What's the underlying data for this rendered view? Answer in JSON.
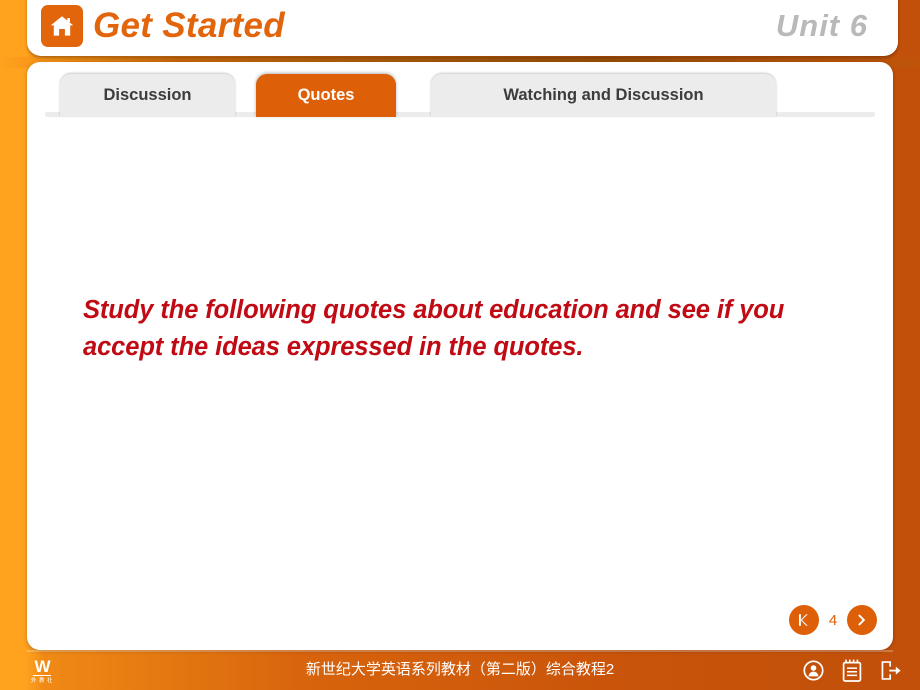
{
  "header": {
    "home_icon": "home-icon",
    "title": "Get Started",
    "unit": "Unit  6"
  },
  "tabs": [
    {
      "label": "Discussion",
      "active": false
    },
    {
      "label": "Quotes",
      "active": true
    },
    {
      "label": "Watching and Discussion",
      "active": false
    }
  ],
  "content": {
    "instruction": "Study the following quotes about education and see if you accept the ideas expressed in the quotes."
  },
  "pager": {
    "prev_icon": "previous-icon",
    "page_number": "4",
    "next_icon": "next-icon"
  },
  "footer": {
    "logo_mark": "W",
    "logo_sub": "外 教 社",
    "title": "新世纪大学英语系列教材（第二版）综合教程2",
    "icons": [
      {
        "name": "user-icon"
      },
      {
        "name": "notepad-icon"
      },
      {
        "name": "exit-icon"
      }
    ]
  },
  "colors": {
    "accent_orange": "#dd5f07",
    "background_orange": "#d8640d",
    "title_orange": "#e2650c",
    "instruction_red": "#c00a14",
    "unit_gray": "#b9b9b9",
    "tab_inactive_bg": "#ececec",
    "panel_white": "#ffffff"
  }
}
